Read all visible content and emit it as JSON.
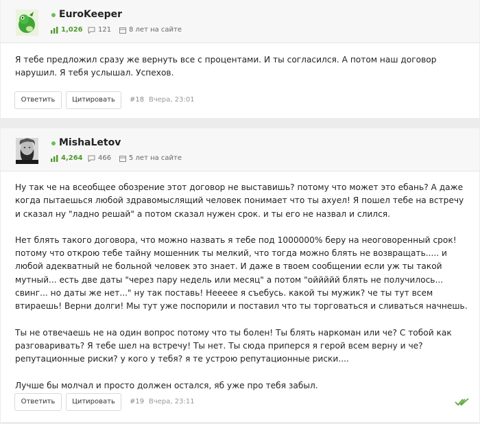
{
  "posts": [
    {
      "username": "EuroKeeper",
      "rating": "1,026",
      "comments": "121",
      "member_since": "8 лет на сайте",
      "body": [
        "Я тебе предложил сразу же вернуть все с процентами. И ты согласился. А потом наш договор нарушил. Я тебя услышал. Успехов."
      ],
      "reply_label": "Ответить",
      "quote_label": "Цитировать",
      "post_number": "#18",
      "timestamp": "Вчера, 23:01"
    },
    {
      "username": "MishaLetov",
      "rating": "4,264",
      "comments": "466",
      "member_since": "5 лет на сайте",
      "body": [
        "Ну так че на всеобщее обозрение этот договор не выставишь? потому что может это ебань? А даже когда пытаешься любой здравомыслящий человек понимает что ты ахуел! Я пошел тебе на встречу и сказал ну \"ладно решай\" а потом сказал нужен срок. и ты его не назвал и слился.",
        "Нет блять такого договора, что можно назвать я тебе под 1000000% беру на неоговоренный срок! потому что открою тебе тайну мошенник ты мелкий, что тогда можно блять не возвращать..... и любой адекватный не больной человек это знает. И даже в твоем сообщении если уж ты такой мутный... есть две даты \"через пару недель или месяц\" а потом \"оййййй блять не получилось... свинг... но даты же нет...\" ну так поставь! Нееееe я съебусь. какой ты мужик? че ты тут всем втираешь! Верни долги! Мы тут уже поспорили и поставил что ты торговаться и сливаться начнешь.",
        "Ты не отвечаешь не на один вопрос потому что ты болен! Ты блять наркоман или че? С тобой как разговаривать? Я тебе шел на встречу! Ты нет. Ты сюда приперся я герой всем верну и че? репутационные риски? у кого у тебя?  я те устрою репутационные риски....",
        "Лучше бы молчал и просто должен остался, яб уже про тебя забыл."
      ],
      "reply_label": "Ответить",
      "quote_label": "Цитировать",
      "post_number": "#19",
      "timestamp": "Вчера, 23:11"
    }
  ],
  "icons": {
    "rating": "rating-bars-icon",
    "comments": "comment-icon",
    "calendar": "calendar-icon",
    "read_status": "double-check-icon"
  },
  "colors": {
    "accent": "#4e9a2d",
    "online": "#6bbf59",
    "check": "#5aa637"
  }
}
